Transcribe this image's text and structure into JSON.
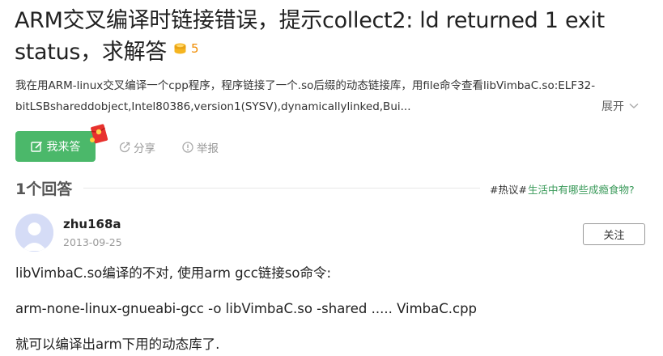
{
  "question": {
    "title": "ARM交叉编译时链接错误，提示collect2: ld returned 1 exit status，求解答",
    "bounty": "5",
    "description": "我在用ARM-linux交叉编译一个cpp程序，程序链接了一个.so后缀的动态链接库，用file命令查看libVimbaC.so:ELF32-bitLSBshareddobject,Intel80386,version1(SYSV),dynamicallylinked,Bui...",
    "expand_label": "展开"
  },
  "actions": {
    "answer_label": "我来答",
    "share_label": "分享",
    "report_label": "举报"
  },
  "answers_section": {
    "count_label": "1个回答",
    "hot_tag": "#热议#",
    "hot_link": "生活中有哪些成瘾食物?"
  },
  "answer": {
    "username": "zhu168a",
    "date": "2013-09-25",
    "follow_label": "关注",
    "lines": [
      "libVimbaC.so编译的不对, 使用arm gcc链接so命令:",
      "arm-none-linux-gnueabi-gcc -o libVimbaC.so -shared ..... VimbaC.cpp",
      "就可以编译出arm下用的动态库了."
    ]
  },
  "colors": {
    "primary_green": "#4bb86a",
    "link_green": "#3a9a5a",
    "bounty_orange": "#f08c00"
  }
}
